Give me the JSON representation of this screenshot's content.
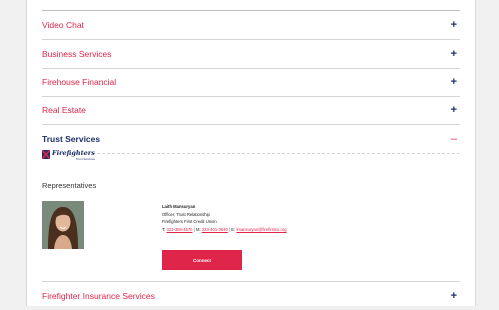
{
  "accordion": {
    "items": [
      {
        "label": "Video Chat",
        "toggle": "+"
      },
      {
        "label": "Business Services",
        "toggle": "+"
      },
      {
        "label": "Firehouse Financial",
        "toggle": "+"
      },
      {
        "label": "Real Estate",
        "toggle": "+"
      },
      {
        "label": "Trust Services",
        "toggle": "–"
      },
      {
        "label": "Firefighter Insurance Services",
        "toggle": "+"
      }
    ],
    "open_index": 4
  },
  "trust_panel": {
    "logo": {
      "name": "Firefighters",
      "subtitle": "Trust Services"
    },
    "representatives_title": "Representatives",
    "rep": {
      "name": "Laith Mansuryan",
      "title": "Officer, Trust Relationship",
      "org": "Firefighters First Credit Union",
      "phone_prefix": "T:",
      "phone": "323-356-4570",
      "mobile_prefix": "M:",
      "mobile": "323-401-3640",
      "email_prefix": "E:",
      "email": "lmansuryan@firefirstcu.org",
      "connect_label": "Connect"
    }
  },
  "colors": {
    "accent": "#e0254a",
    "navy": "#1f2f6b"
  }
}
